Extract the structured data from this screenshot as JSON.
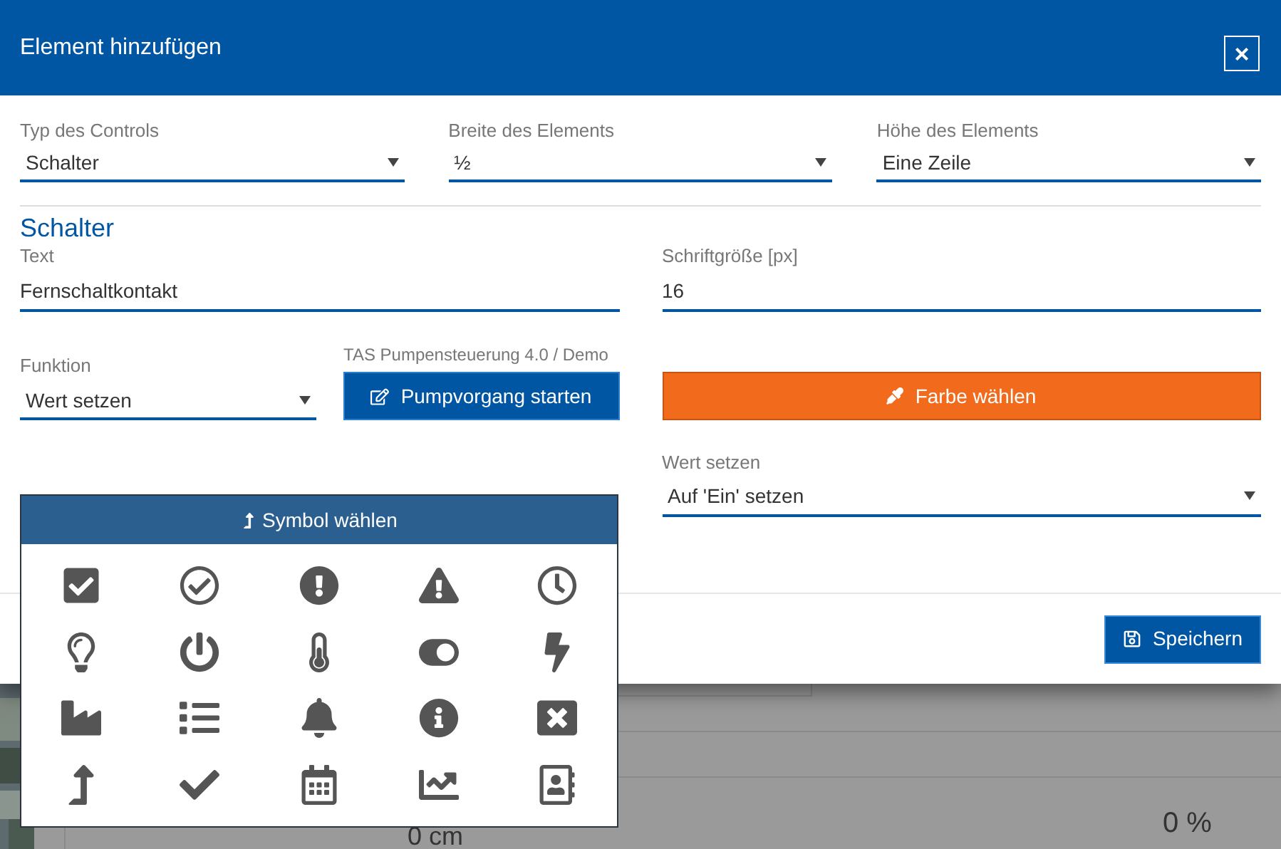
{
  "dialog": {
    "title": "Element hinzufügen",
    "close_label": "×"
  },
  "top_fields": [
    {
      "label": "Typ des Controls",
      "value": "Schalter"
    },
    {
      "label": "Breite des Elements",
      "value": "½"
    },
    {
      "label": "Höhe des Elements",
      "value": "Eine Zeile"
    }
  ],
  "section_title": "Schalter",
  "text_field": {
    "label": "Text",
    "value": "Fernschaltkontakt"
  },
  "font_size_field": {
    "label": "Schriftgröße [px]",
    "value": "16"
  },
  "function_field": {
    "label": "Funktion",
    "value": "Wert setzen"
  },
  "target": {
    "label": "TAS Pumpensteuerung 4.0 / Demo",
    "button": "Pumpvorgang starten"
  },
  "color_button": {
    "label": "Farbe wählen",
    "color": "#f26a1b"
  },
  "value_field": {
    "label": "Wert setzen",
    "value": "Auf 'Ein' setzen"
  },
  "symbol_picker": {
    "button": "Symbol wählen"
  },
  "save_button": "Speichern",
  "background": {
    "readings": [
      "0 cm",
      "0 %"
    ]
  }
}
